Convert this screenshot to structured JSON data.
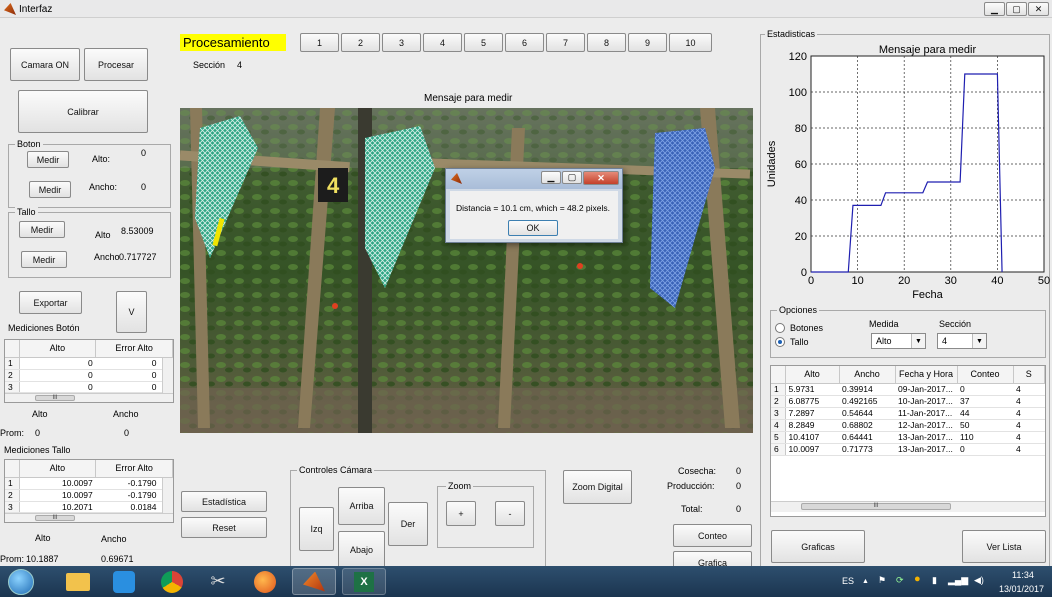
{
  "window": {
    "title": "Interfaz"
  },
  "top": {
    "processing_label": "Procesamiento",
    "section_label": "Sección",
    "section_value": "4",
    "section_buttons": [
      "1",
      "2",
      "3",
      "4",
      "5",
      "6",
      "7",
      "8",
      "9",
      "10"
    ],
    "camera_on": "Camara ON",
    "process": "Procesar",
    "calibrate": "Calibrar"
  },
  "boton_panel": {
    "title": "Boton",
    "measure1": "Medir",
    "alto_label": "Alto:",
    "alto_value": "0",
    "measure2": "Medir",
    "ancho_label": "Ancho:",
    "ancho_value": "0"
  },
  "tallo_panel": {
    "title": "Tallo",
    "measure1": "Medir",
    "alto_label": "Alto",
    "alto_value": "8.53009",
    "measure2": "Medir",
    "ancho_label": "Ancho",
    "ancho_value": "0.717727"
  },
  "export": {
    "label": "Exportar",
    "v_label": "V"
  },
  "boton_table": {
    "title": "Mediciones Botón",
    "columns": [
      "Alto",
      "Error Alto"
    ],
    "rows": [
      [
        "1",
        "0",
        "0"
      ],
      [
        "2",
        "0",
        "0"
      ],
      [
        "3",
        "0",
        "0"
      ]
    ],
    "foot_alto": "Alto",
    "foot_ancho": "Ancho",
    "prom_label": "Prom:",
    "prom_alto": "0",
    "prom_ancho": "0"
  },
  "tallo_table": {
    "title": "Mediciones Tallo",
    "columns": [
      "Alto",
      "Error Alto"
    ],
    "rows": [
      [
        "1",
        "10.0097",
        "-0.1790"
      ],
      [
        "2",
        "10.0097",
        "-0.1790"
      ],
      [
        "3",
        "10.2071",
        "0.0184"
      ]
    ],
    "foot_alto": "Alto",
    "foot_ancho": "Ancho",
    "prom_label": "Prom:",
    "prom_alto": "10.1887",
    "prom_ancho": "0.69671"
  },
  "image_area": {
    "title": "Mensaje para medir",
    "stake_number": "4"
  },
  "dialog": {
    "message": "Distancia = 10.1 cm, which = 48.2 pixels.",
    "ok": "OK"
  },
  "bottom": {
    "statistics": "Estadística",
    "reset": "Reset",
    "camera_controls_title": "Controles Cámara",
    "up": "Arriba",
    "down": "Abajo",
    "left": "Izq",
    "right": "Der",
    "zoom_title": "Zoom",
    "zoom_in": "+",
    "zoom_out": "-",
    "digital_zoom": "Zoom Digital",
    "harvest_label": "Cosecha:",
    "harvest_value": "0",
    "production_label": "Producción:",
    "production_value": "0",
    "total_label": "Total:",
    "total_value": "0",
    "count": "Conteo",
    "graph": "Grafica"
  },
  "stats": {
    "panel_title": "Estadisticas",
    "graphs": "Graficas",
    "view_list": "Ver Lista"
  },
  "chart_data": {
    "type": "line",
    "title": "Mensaje para medir",
    "xlabel": "Fecha",
    "ylabel": "Unidades",
    "xlim": [
      0,
      50
    ],
    "ylim": [
      0,
      120
    ],
    "x_ticks": [
      "0",
      "10",
      "20",
      "30",
      "40",
      "50"
    ],
    "y_ticks": [
      "0",
      "20",
      "40",
      "60",
      "80",
      "100",
      "120"
    ],
    "grid": true,
    "color": "#1f1fb0",
    "series": [
      {
        "x": [
          0,
          8,
          9,
          15,
          16,
          24,
          25,
          32,
          33,
          40,
          41
        ],
        "y": [
          0,
          0,
          37,
          37,
          44,
          44,
          50,
          50,
          110,
          110,
          0
        ]
      }
    ]
  },
  "options": {
    "title": "Opciones",
    "radio1": "Botones",
    "radio2": "Tallo",
    "selected": "Tallo",
    "medida_label": "Medida",
    "medida_value": "Alto",
    "seccion_label": "Sección",
    "seccion_value": "4"
  },
  "list_table": {
    "columns": [
      "Alto",
      "Ancho",
      "Fecha y Hora",
      "Conteo",
      "S"
    ],
    "rows": [
      [
        "1",
        "5.9731",
        "0.39914",
        "09-Jan-2017...",
        "0",
        "4"
      ],
      [
        "2",
        "6.08775",
        "0.492165",
        "10-Jan-2017...",
        "37",
        "4"
      ],
      [
        "3",
        "7.2897",
        "0.54644",
        "11-Jan-2017...",
        "44",
        "4"
      ],
      [
        "4",
        "8.2849",
        "0.68802",
        "12-Jan-2017...",
        "50",
        "4"
      ],
      [
        "5",
        "10.4107",
        "0.64441",
        "13-Jan-2017...",
        "110",
        "4"
      ],
      [
        "6",
        "10.0097",
        "0.71773",
        "13-Jan-2017...",
        "0",
        "4"
      ]
    ]
  },
  "taskbar": {
    "lang": "ES",
    "time": "11:34",
    "date": "13/01/2017",
    "icons": [
      "start-icon",
      "file-explorer-icon",
      "media-player-icon",
      "chrome-icon",
      "snipping-tool-icon",
      "firefox-icon",
      "matlab-icon",
      "excel-icon"
    ]
  }
}
